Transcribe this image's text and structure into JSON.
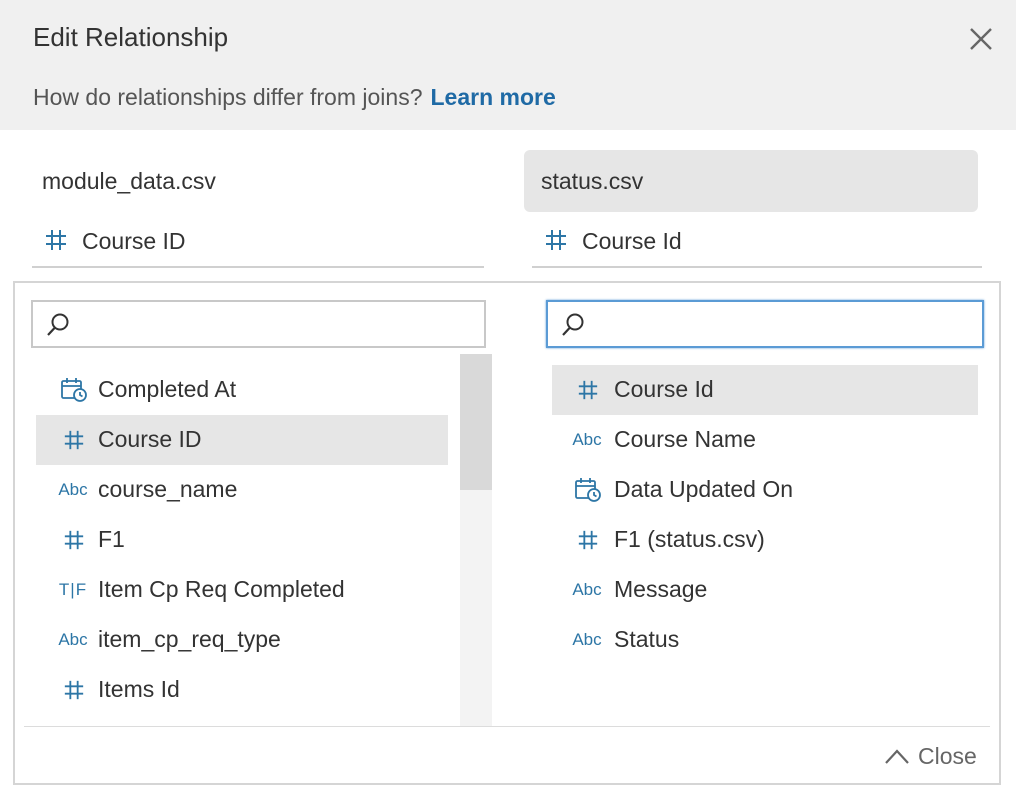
{
  "dialog": {
    "title": "Edit Relationship",
    "subtitle": "How do relationships differ from joins?",
    "learn_more": "Learn more"
  },
  "left": {
    "table": "module_data.csv",
    "selected_field": "Course ID",
    "search_placeholder": "",
    "fields": [
      {
        "label": "Completed At",
        "icon": "calendar-clock-icon"
      },
      {
        "label": "Course ID",
        "icon": "number-icon",
        "selected": true
      },
      {
        "label": "course_name",
        "icon": "abc-icon"
      },
      {
        "label": "F1",
        "icon": "number-icon"
      },
      {
        "label": "Item Cp Req Completed",
        "icon": "boolean-icon"
      },
      {
        "label": "item_cp_req_type",
        "icon": "abc-icon"
      },
      {
        "label": "Items Id",
        "icon": "number-icon"
      }
    ]
  },
  "right": {
    "table": "status.csv",
    "selected_field": "Course Id",
    "search_placeholder": "",
    "fields": [
      {
        "label": "Course Id",
        "icon": "number-icon",
        "selected": true
      },
      {
        "label": "Course Name",
        "icon": "abc-icon"
      },
      {
        "label": "Data Updated On",
        "icon": "calendar-clock-icon"
      },
      {
        "label": "F1 (status.csv)",
        "icon": "number-icon"
      },
      {
        "label": "Message",
        "icon": "abc-icon"
      },
      {
        "label": "Status",
        "icon": "abc-icon"
      }
    ]
  },
  "icon_text": {
    "abc": "Abc",
    "boolean": "T|F"
  },
  "footer": {
    "close_label": "Close"
  },
  "colors": {
    "accent": "#1f6aa5",
    "icon": "#2d76a6",
    "selected_bg": "#e6e6e6",
    "header_bg": "#f0f0f0"
  }
}
